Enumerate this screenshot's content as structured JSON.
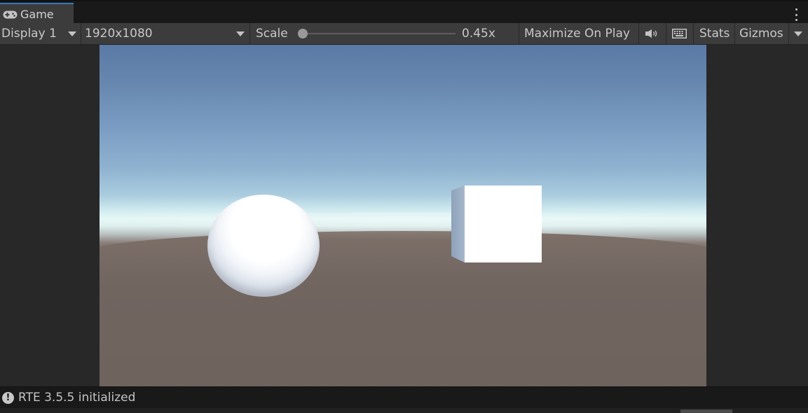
{
  "window": {
    "tab_label": "Game",
    "tab_icon": "gamepad-icon"
  },
  "toolbar": {
    "display_label": "Display 1",
    "resolution_label": "1920x1080",
    "scale_label": "Scale",
    "scale_value": "0.45x",
    "maximize_label": "Maximize On Play",
    "mute_icon": "speaker-icon",
    "keyboard_icon": "keyboard-icon",
    "stats_label": "Stats",
    "gizmos_label": "Gizmos"
  },
  "status": {
    "message": "RTE 3.5.5 initialized",
    "icon": "warning-icon",
    "icon_glyph": "!"
  },
  "colors": {
    "accent": "#3a79bb",
    "background": "#282828",
    "toolbar": "#3c3c3c",
    "sky_top": "#5a7aa6",
    "ground": "#6e625d"
  }
}
